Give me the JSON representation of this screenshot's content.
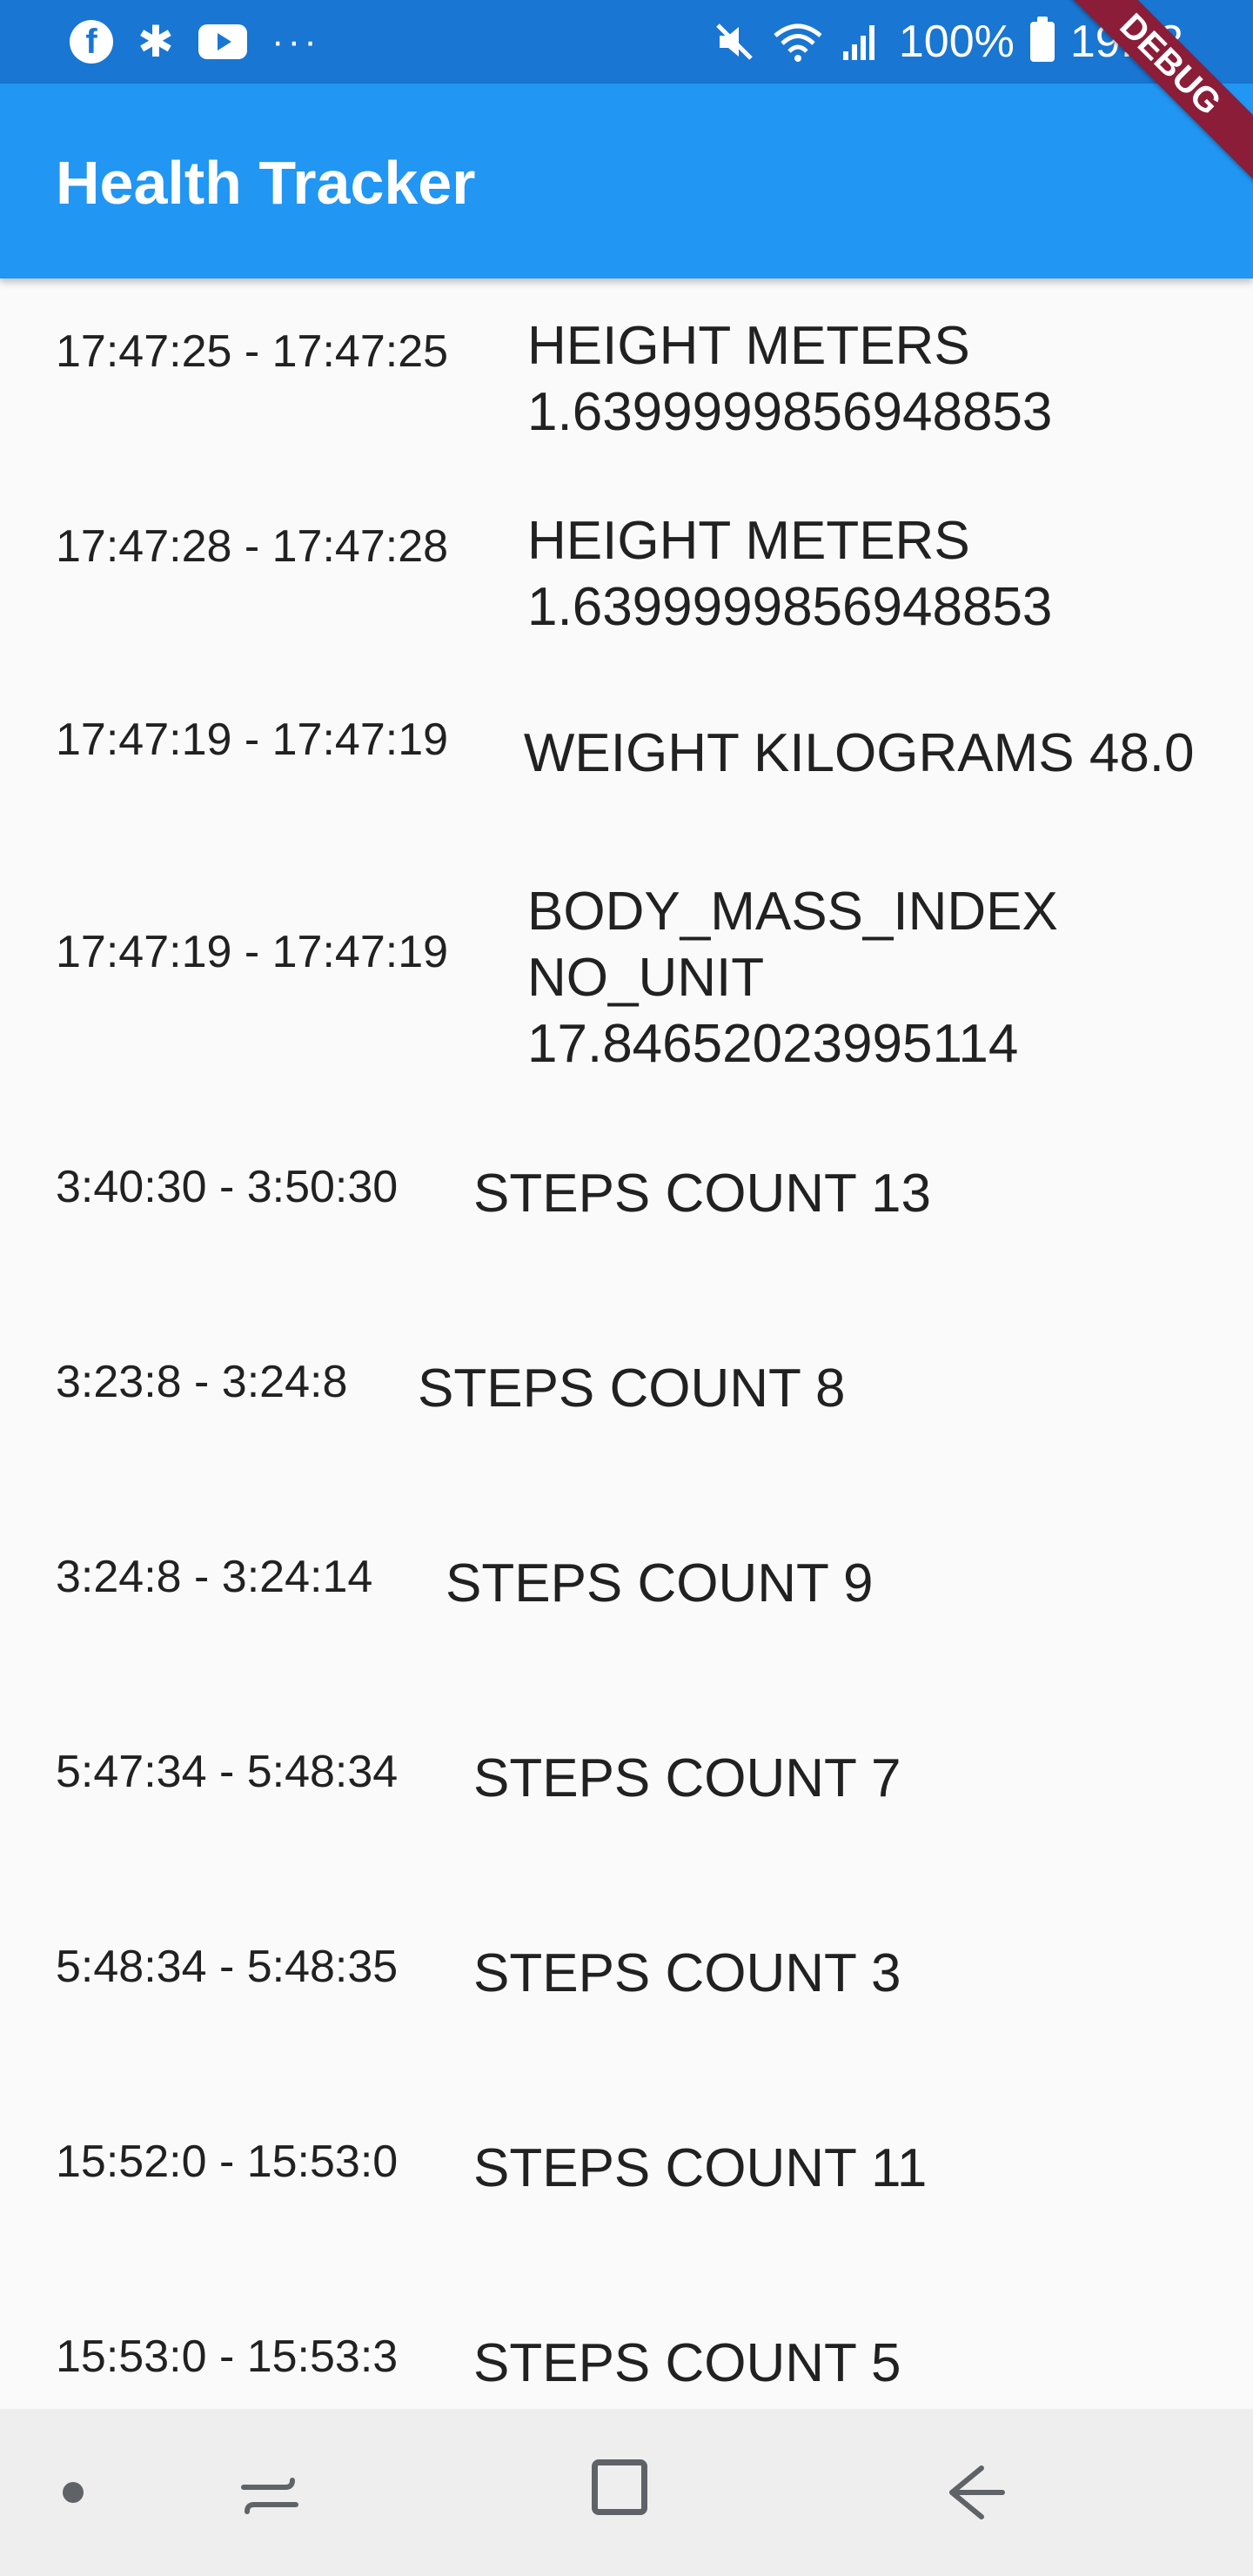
{
  "status_bar": {
    "left_icons": [
      "facebook-icon",
      "flower-icon",
      "youtube-icon",
      "more-icon"
    ],
    "battery_percent": "100%",
    "time": "19:43",
    "right_icons": [
      "mute-icon",
      "wifi-icon",
      "signal-icon",
      "battery-icon"
    ]
  },
  "debug_banner": {
    "label": "DEBUG"
  },
  "app_bar": {
    "title": "Health Tracker"
  },
  "entries": [
    {
      "time_range": "17:47:25 - 17:47:25",
      "metric": "HEIGHT METERS 1.6399999856948853"
    },
    {
      "time_range": "17:47:28 - 17:47:28",
      "metric": "HEIGHT METERS 1.6399999856948853"
    },
    {
      "time_range": "17:47:19 - 17:47:19",
      "metric": "WEIGHT KILOGRAMS 48.0"
    },
    {
      "time_range": "17:47:19 - 17:47:19",
      "metric": "BODY_MASS_INDEX NO_UNIT 17.84652023995114"
    },
    {
      "time_range": "3:40:30 - 3:50:30",
      "metric": "STEPS COUNT 13"
    },
    {
      "time_range": "3:23:8 - 3:24:8",
      "metric": "STEPS COUNT 8"
    },
    {
      "time_range": "3:24:8 - 3:24:14",
      "metric": "STEPS COUNT 9"
    },
    {
      "time_range": "5:47:34 - 5:48:34",
      "metric": "STEPS COUNT 7"
    },
    {
      "time_range": "5:48:34 - 5:48:35",
      "metric": "STEPS COUNT 3"
    },
    {
      "time_range": "15:52:0 - 15:53:0",
      "metric": "STEPS COUNT 11"
    },
    {
      "time_range": "15:53:0 - 15:53:3",
      "metric": "STEPS COUNT 5"
    }
  ],
  "nav_bar": {
    "icons": [
      "dot-icon",
      "recents-icon",
      "home-icon",
      "back-icon"
    ]
  },
  "colors": {
    "status_bar": "#1976d2",
    "app_bar": "#2196f3",
    "debug_ribbon": "#8b1d38",
    "background": "#fafafa",
    "nav_bar": "#eeeeee"
  }
}
